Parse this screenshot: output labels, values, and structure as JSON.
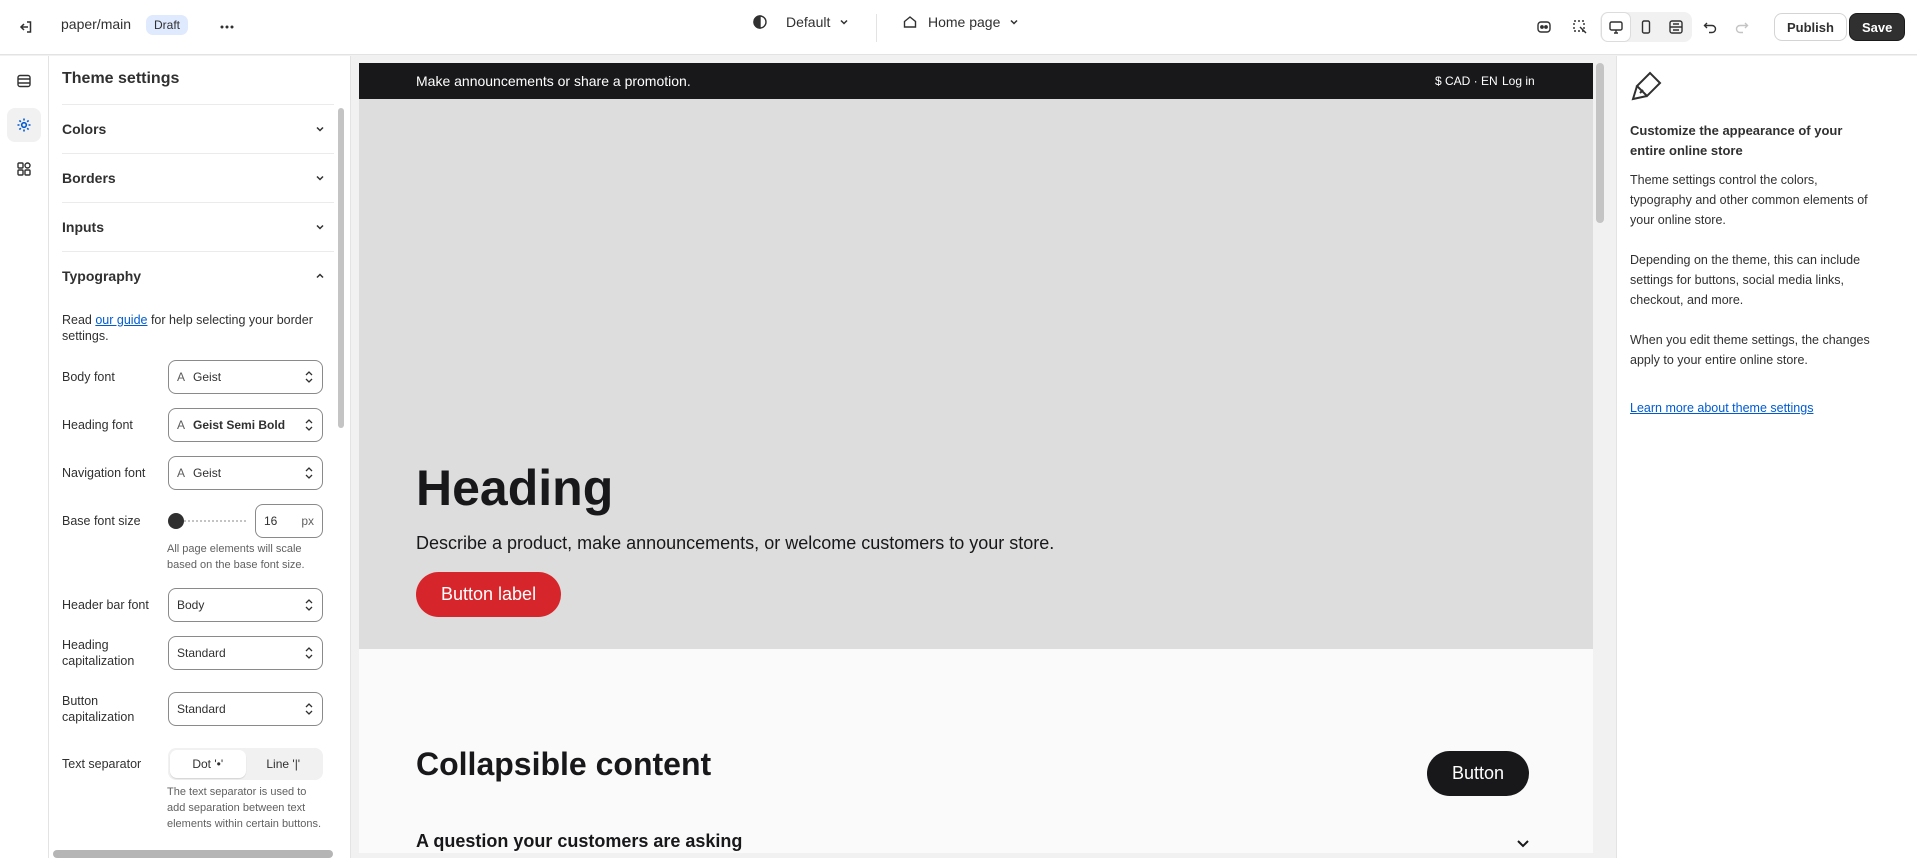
{
  "topbar": {
    "repo": "paper/main",
    "status_badge": "Draft",
    "theme_selector": "Default",
    "page_selector": "Home page",
    "publish_label": "Publish",
    "save_label": "Save"
  },
  "sidebar": {
    "title": "Theme settings",
    "sections": [
      "Colors",
      "Borders",
      "Inputs",
      "Typography"
    ],
    "typography": {
      "intro_prefix": "Read ",
      "intro_link": "our guide",
      "intro_suffix": " for help selecting your border settings.",
      "body_font_label": "Body font",
      "body_font_value": "Geist",
      "heading_font_label": "Heading font",
      "heading_font_value": "Geist Semi Bold",
      "navigation_font_label": "Navigation font",
      "navigation_font_value": "Geist",
      "base_font_size_label": "Base font size",
      "base_font_size_value": "16",
      "base_font_size_unit": "px",
      "base_font_size_help": "All page elements will scale based on the base font size.",
      "header_bar_font_label": "Header bar font",
      "header_bar_font_value": "Body",
      "heading_capitalization_label": "Heading capitalization",
      "heading_capitalization_value": "Standard",
      "button_capitalization_label": "Button capitalization",
      "button_capitalization_value": "Standard",
      "text_separator_label": "Text separator",
      "text_separator_options": [
        "Dot '•'",
        "Line '|'"
      ],
      "text_separator_selected": "Dot '•'",
      "text_separator_help": "The text separator is used to add separation between text elements within certain buttons."
    }
  },
  "preview": {
    "announcement": "Make announcements or share a promotion.",
    "currency_lang": "$ CAD · EN",
    "login": "Log in",
    "hero_heading": "Heading",
    "hero_text": "Describe a product, make announcements, or welcome customers to your store.",
    "hero_button": "Button label",
    "collapsible_title": "Collapsible content",
    "collapsible_button": "Button",
    "collapsible_question": "A question your customers are asking"
  },
  "right_panel": {
    "heading": "Customize the appearance of your entire online store",
    "para1": "Theme settings control the colors, typography and other common elements of your online store.",
    "para2": "Depending on the theme, this can include settings for buttons, social media links, checkout, and more.",
    "para3": "When you edit theme settings, the changes apply to your entire online store.",
    "link": "Learn more about theme settings"
  },
  "colors": {
    "accent_red": "#d7262b",
    "announcement_bg": "#18181b",
    "hero_bg": "#dddddd",
    "link_blue": "#005bd3",
    "dark_button": "#303030"
  },
  "icons": [
    "exit-icon",
    "more-icon",
    "theme-icon",
    "home-icon",
    "inspector-icon",
    "select-icon",
    "desktop-icon",
    "mobile-icon",
    "fullwidth-icon",
    "undo-icon",
    "redo-icon",
    "sections-icon",
    "settings-gear-icon",
    "apps-icon",
    "paintbrush-icon"
  ]
}
